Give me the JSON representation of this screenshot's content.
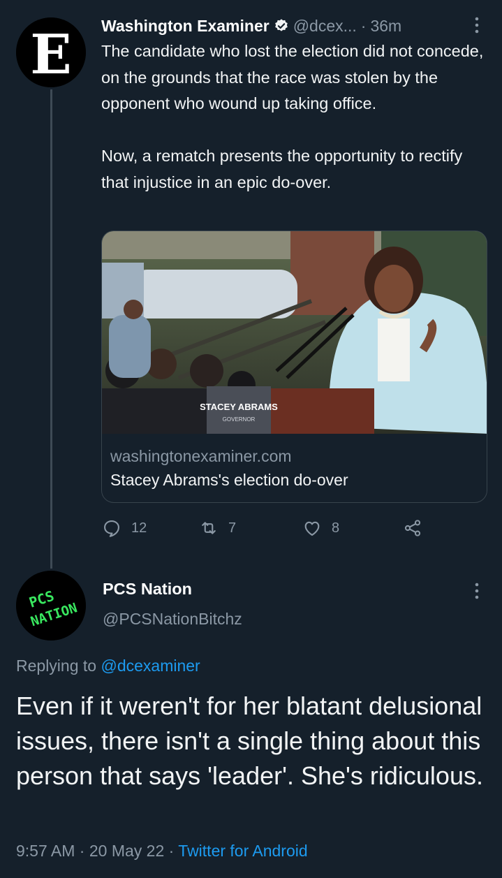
{
  "tweet1": {
    "author_name": "Washington Examiner",
    "handle": "@dcex...",
    "separator": "·",
    "time": "36m",
    "text": "The candidate who lost the election did not concede, on the grounds that the race was stolen by the opponent who wound up taking office.\n\nNow, a rematch presents the opportunity to rectify that injustice in an epic do-over.",
    "avatar_logo": "E",
    "card": {
      "podium_line1": "STACEY ABRAMS",
      "podium_line2": "GOVERNOR",
      "domain": "washingtonexaminer.com",
      "title": "Stacey Abrams's election do-over"
    },
    "actions": {
      "replies": "12",
      "retweets": "7",
      "likes": "8"
    }
  },
  "tweet2": {
    "author_name": "PCS Nation",
    "handle": "@PCSNationBitchz",
    "avatar_line1": "PCS",
    "avatar_line2": "NATION",
    "replying_prefix": "Replying to",
    "replying_to": "@dcexaminer",
    "text": "Even if it weren't for her blatant delusional issues, there isn't a single thing about this person that says 'leader'. She's ridiculous.",
    "time": "9:57 AM",
    "date": "20 May 22",
    "separator": "·",
    "client": "Twitter for Android"
  },
  "icons": [
    "verified-icon",
    "more-icon",
    "reply-icon",
    "retweet-icon",
    "like-icon",
    "share-icon"
  ],
  "colors": {
    "background": "#15202b",
    "muted": "#8b98a5",
    "link": "#1d9bf0",
    "accent_green": "#39e75f"
  }
}
